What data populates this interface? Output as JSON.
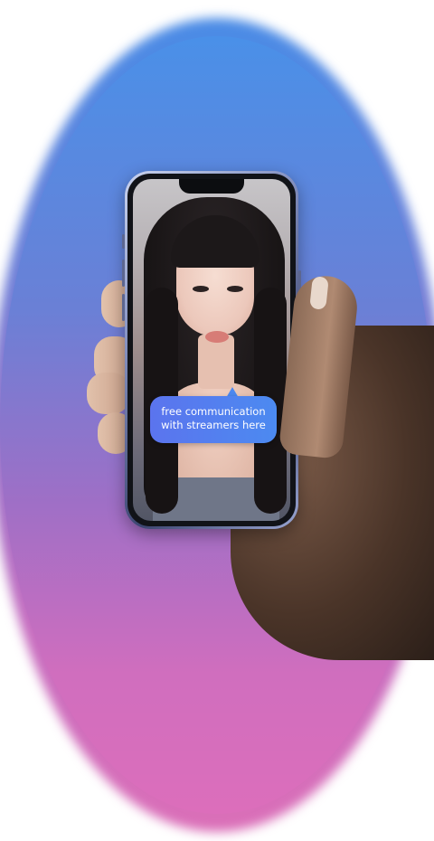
{
  "bubble": {
    "text": "free communication\nwith streamers here"
  },
  "colors": {
    "gradient_top": "#4a8ce6",
    "gradient_bottom": "#db6fb8",
    "bubble": "#5b74ee"
  }
}
